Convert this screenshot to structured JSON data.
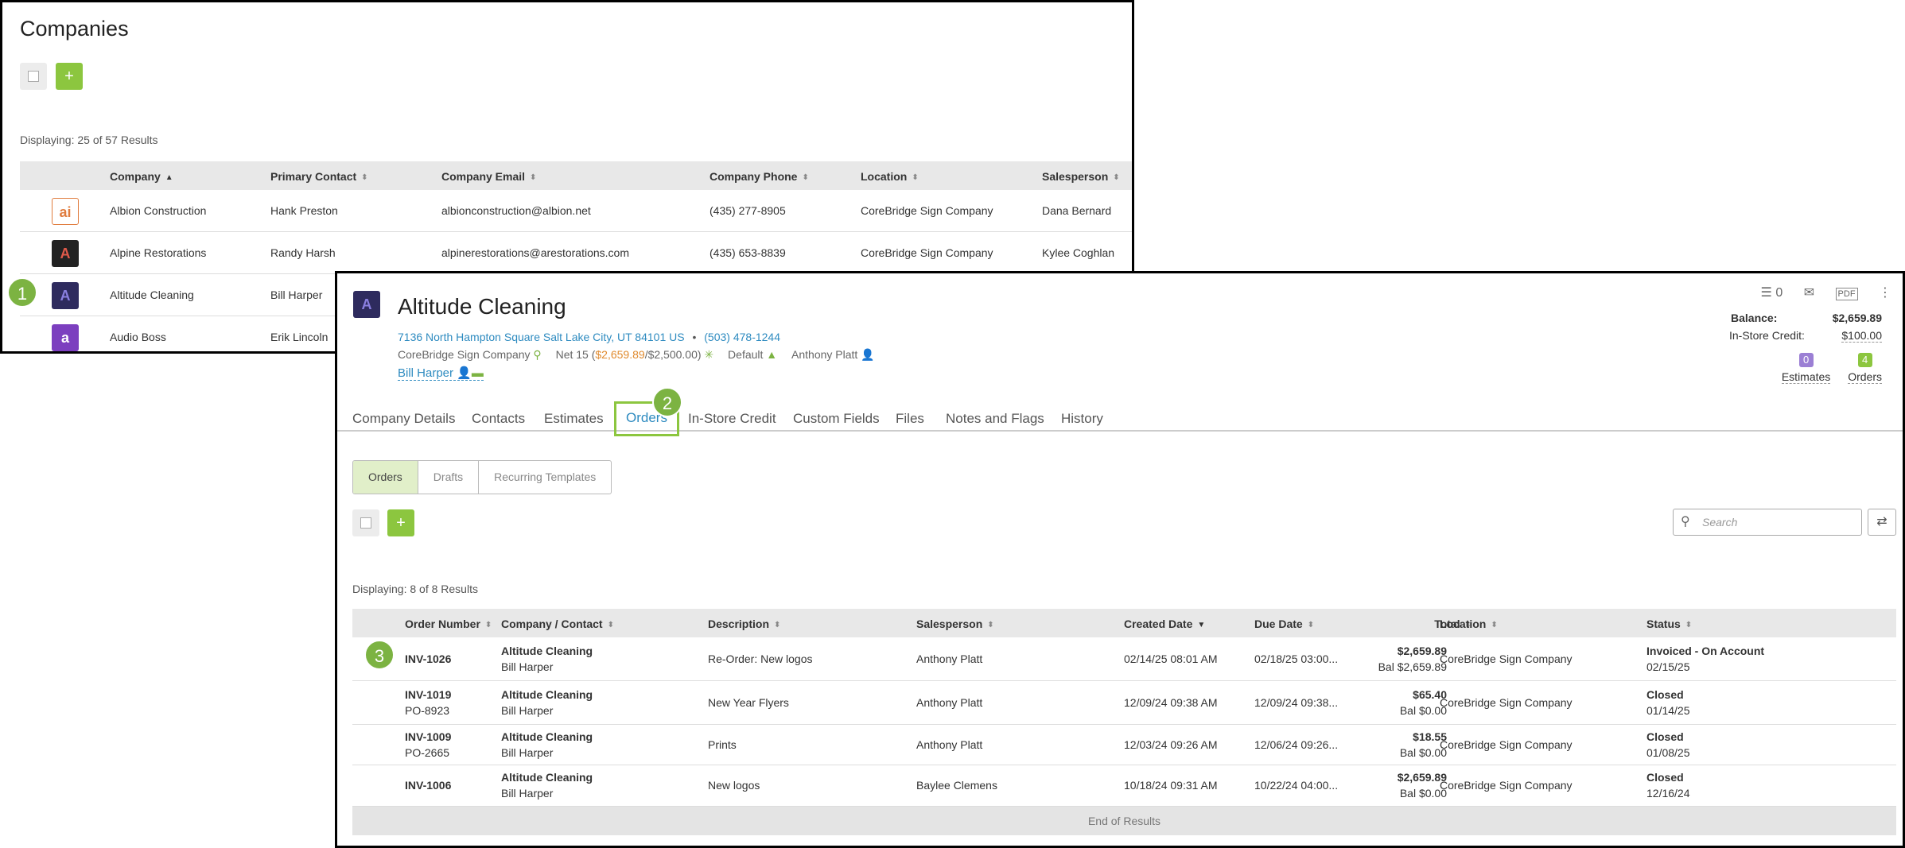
{
  "companies": {
    "title": "Companies",
    "add_label": "+",
    "displaying": "Displaying: 25 of 57 Results",
    "columns": {
      "company": "Company",
      "primary_contact": "Primary Contact",
      "company_email": "Company Email",
      "company_phone": "Company Phone",
      "location": "Location",
      "salesperson": "Salesperson"
    },
    "rows": [
      {
        "logo": "ai",
        "company": "Albion Construction",
        "contact": "Hank Preston",
        "email": "albionconstruction@albion.net",
        "phone": "(435) 277-8905",
        "location": "CoreBridge Sign Company",
        "salesperson": "Dana Bernard"
      },
      {
        "logo": "A",
        "company": "Alpine Restorations",
        "contact": "Randy Harsh",
        "email": "alpinerestorations@arestorations.com",
        "phone": "(435) 653-8839",
        "location": "CoreBridge Sign Company",
        "salesperson": "Kylee Coghlan"
      },
      {
        "logo": "A",
        "company": "Altitude Cleaning",
        "contact": "Bill Harper"
      },
      {
        "logo": "a",
        "company": "Audio Boss",
        "contact": "Erik Lincoln"
      }
    ]
  },
  "badges": {
    "step1": "1",
    "step2": "2",
    "step3": "3"
  },
  "detail": {
    "logo": "A",
    "name": "Altitude Cleaning",
    "address": "7136 North Hampton Square Salt Lake City, UT 84101 US",
    "separator": "•",
    "phone": "(503) 478-1244",
    "location": "CoreBridge Sign Company",
    "terms_prefix": "Net 15 (",
    "terms_balance": "$2,659.89",
    "terms_limit": "/$2,500.00)",
    "tax": "Default",
    "salesperson": "Anthony Platt",
    "contact": "Bill Harper",
    "toolbar": {
      "tasks": "☰ 0",
      "mail": "✉",
      "pdf": "PDF",
      "more": "⋮"
    },
    "balance_label": "Balance:",
    "balance_value": "$2,659.89",
    "credit_label": "In-Store Credit:",
    "credit_value": "$100.00",
    "estimates_count": "0",
    "estimates_label": "Estimates",
    "orders_count": "4",
    "orders_label": "Orders",
    "tabs": [
      "Company Details",
      "Contacts",
      "Estimates",
      "Orders",
      "In-Store Credit",
      "Custom Fields",
      "Files",
      "Notes and Flags",
      "History"
    ],
    "subtabs": [
      "Orders",
      "Drafts",
      "Recurring Templates"
    ],
    "search_placeholder": "Search",
    "displaying": "Displaying: 8 of 8 Results",
    "columns": {
      "order_number": "Order Number",
      "company_contact": "Company / Contact",
      "description": "Description",
      "salesperson": "Salesperson",
      "created": "Created Date",
      "due": "Due Date",
      "total": "Total",
      "location": "Location",
      "status": "Status"
    },
    "orders": [
      {
        "num": "INV-1026",
        "po": "",
        "company": "Altitude Cleaning",
        "contact": "Bill Harper",
        "desc": "Re-Order: New logos",
        "sales": "Anthony Platt",
        "created": "02/14/25 08:01 AM",
        "due": "02/18/25 03:00...",
        "total": "$2,659.89",
        "bal": "Bal $2,659.89",
        "location": "CoreBridge Sign Company",
        "status": "Invoiced - On Account",
        "status_date": "02/15/25"
      },
      {
        "num": "INV-1019",
        "po": "PO-8923",
        "company": "Altitude Cleaning",
        "contact": "Bill Harper",
        "desc": "New Year Flyers",
        "sales": "Anthony Platt",
        "created": "12/09/24 09:38 AM",
        "due": "12/09/24 09:38...",
        "total": "$65.40",
        "bal": "Bal $0.00",
        "location": "CoreBridge Sign Company",
        "status": "Closed",
        "status_date": "01/14/25"
      },
      {
        "num": "INV-1009",
        "po": "PO-2665",
        "company": "Altitude Cleaning",
        "contact": "Bill Harper",
        "desc": "Prints",
        "sales": "Anthony Platt",
        "created": "12/03/24 09:26 AM",
        "due": "12/06/24 09:26...",
        "total": "$18.55",
        "bal": "Bal $0.00",
        "location": "CoreBridge Sign Company",
        "status": "Closed",
        "status_date": "01/08/25"
      },
      {
        "num": "INV-1006",
        "po": "",
        "company": "Altitude Cleaning",
        "contact": "Bill Harper",
        "desc": "New logos",
        "sales": "Baylee Clemens",
        "created": "10/18/24 09:31 AM",
        "due": "10/22/24 04:00...",
        "total": "$2,659.89",
        "bal": "Bal $0.00",
        "location": "CoreBridge Sign Company",
        "status": "Closed",
        "status_date": "12/16/24"
      }
    ],
    "end_of_results": "End of Results"
  },
  "colors": {
    "accent_green": "#8cc63f",
    "link_blue": "#2e8bc0",
    "estimate_purple": "#9b7fd4"
  }
}
